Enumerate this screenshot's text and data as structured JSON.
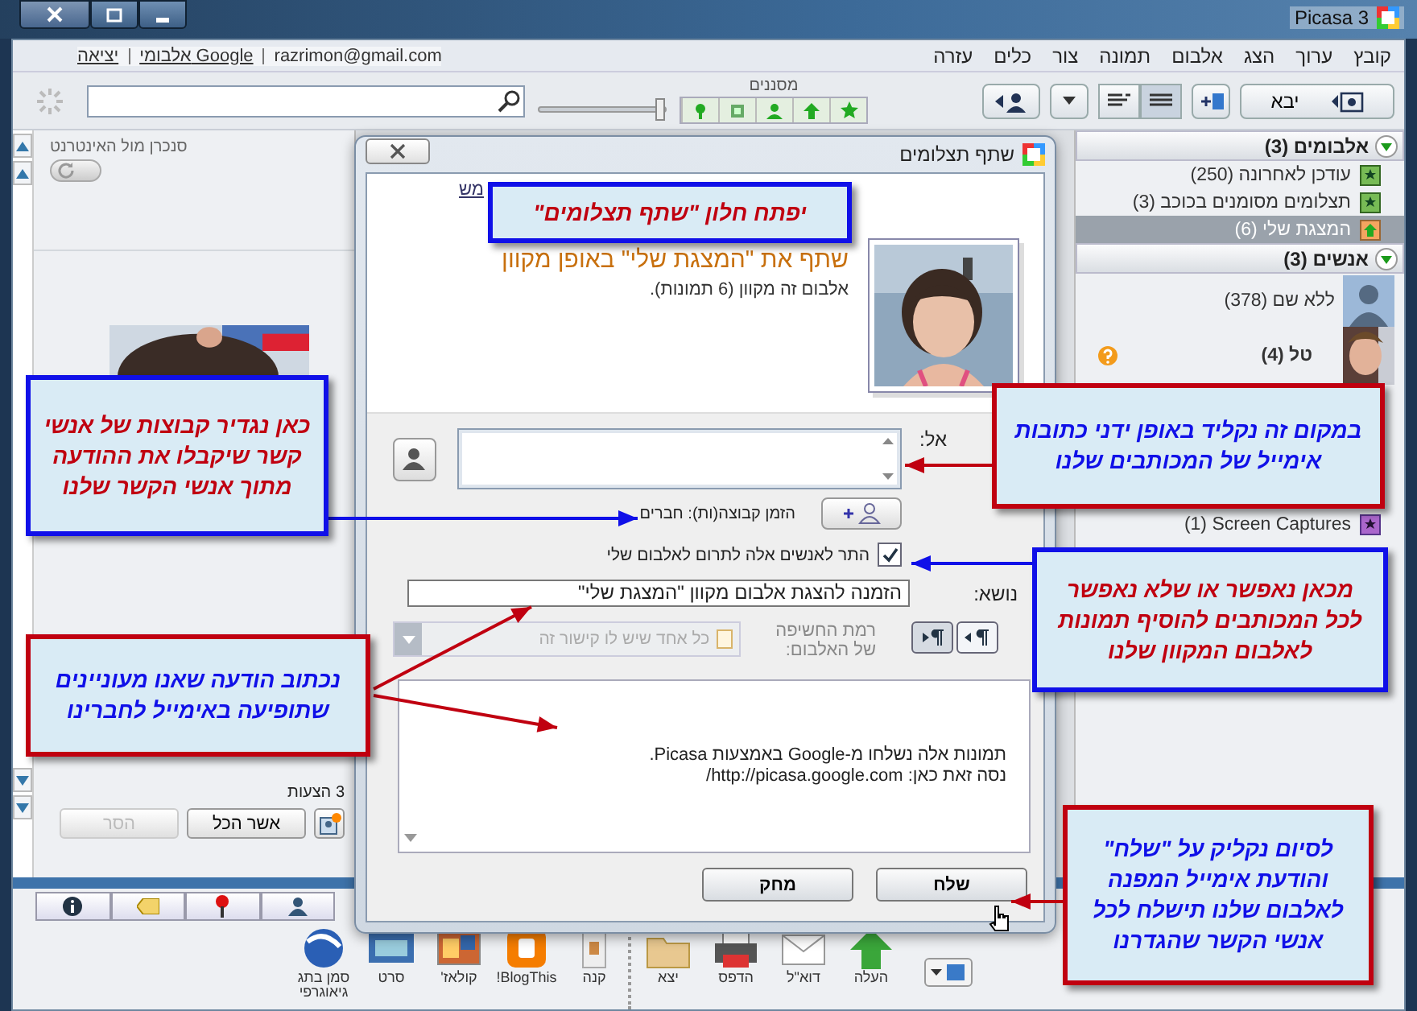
{
  "window": {
    "title": "Picasa 3"
  },
  "account": {
    "sign_out": "יציאה",
    "web_albums": "אלבומי Google",
    "email": "razrimon@gmail.com"
  },
  "menu": [
    "קובץ",
    "ערוך",
    "הצג",
    "אלבום",
    "תמונה",
    "צור",
    "כלים",
    "עזרה"
  ],
  "toolbar": {
    "import_button": "יבא",
    "filters_label": "מסננים",
    "size_slider": {
      "level": 0.95
    }
  },
  "sidebar": {
    "sections": [
      {
        "title": "אלבומים (3)",
        "expanded": true,
        "items": [
          {
            "label": "עודכן לאחרונה (250)",
            "kind": "album",
            "selected": false
          },
          {
            "label": "תצלומים מסומנים בכוכב (3)",
            "kind": "album",
            "selected": false
          },
          {
            "label": "המצגת שלי (6)",
            "kind": "upload",
            "selected": true
          }
        ]
      },
      {
        "title": "אנשים (3)",
        "expanded": true,
        "items": [
          {
            "label": "ללא שם (378)",
            "kind": "person",
            "selected": false
          },
          {
            "label": "טל (4)",
            "kind": "face",
            "selected": false,
            "suggestions": true
          }
        ]
      }
    ],
    "folders": [
      {
        "label": "(1) Screen Captures",
        "selected": false
      }
    ]
  },
  "left_panel": {
    "sync_label": "סנכרן מול האינטרנט",
    "sync_on": false,
    "suggestions": "3 הצעות",
    "accept_all": "אשר הכל",
    "remove": {
      "label": "הסר",
      "disabled": true
    }
  },
  "dialog": {
    "title": "שתף תצלומים",
    "link": "מש",
    "heading": "שתף את \"המצגת שלי\" באופן מקוון",
    "subheading": "אלבום זה מקוון (6 תמונות).",
    "to_label": "אל:",
    "group_invite": "הזמן קבוצה(ות): חברים",
    "allow_contribute": {
      "label": "התר לאנשים אלה לתרום לאלבום שלי",
      "checked": true
    },
    "subject_label": "נושא:",
    "subject": "הזמנה להצגת אלבום מקוון \"המצגת שלי\"",
    "visibility_label": "רמת החשיפה של האלבום:",
    "visibility": {
      "value": "כל אחד שיש לו קישור זה",
      "disabled": true
    },
    "message": [
      "תמונות אלה נשלחו מ-Google באמצעות Picasa.",
      "נסה זאת כאן: http://picasa.google.com/"
    ],
    "send": "שלח",
    "discard": "מחק"
  },
  "tool_groups": [
    [
      {
        "label": "העלה",
        "kind": "upload"
      },
      {
        "label": "דוא\"ל",
        "kind": "email"
      },
      {
        "label": "הדפס",
        "kind": "print"
      },
      {
        "label": "יצא",
        "kind": "export"
      }
    ],
    [
      {
        "label": "קנה",
        "kind": "shop"
      },
      {
        "label": "BlogThis!",
        "kind": "blog"
      },
      {
        "label": "קולאז'",
        "kind": "collage"
      },
      {
        "label": "סרט",
        "kind": "movie"
      },
      {
        "label": "סמן בתג גיאוגרפי",
        "kind": "geotag"
      }
    ]
  ],
  "callouts": [
    {
      "kind": "blue",
      "lines": [
        "יפתח חלון \"שתף תצלומים\""
      ]
    },
    {
      "kind": "red",
      "lines": [
        "במקום זה נקליד באופן ידני כתובות",
        "אימייל של המכותבים שלנו"
      ]
    },
    {
      "kind": "blue",
      "lines": [
        "כאן נגדיר קבוצות של אנשי",
        "קשר שיקבלו את ההודעה",
        "מתוך אנשי הקשר שלנו"
      ]
    },
    {
      "kind": "blue",
      "lines": [
        "מכאן נאפשר או שלא נאפשר",
        "לכל המכותבים להוסיף תמונות",
        "לאלבום המקוון שלנו"
      ]
    },
    {
      "kind": "red",
      "lines": [
        "נכתוב הודעה שאנו מעוניינים",
        "שתופיעה באימייל לחברינו"
      ]
    },
    {
      "kind": "red",
      "lines": [
        "לסיום נקליק על \"שלח\"",
        "והודעת אימייל המפנה",
        "לאלבום שלנו תישלח לכל",
        "אנשי הקשר שהגדרנו"
      ]
    }
  ]
}
